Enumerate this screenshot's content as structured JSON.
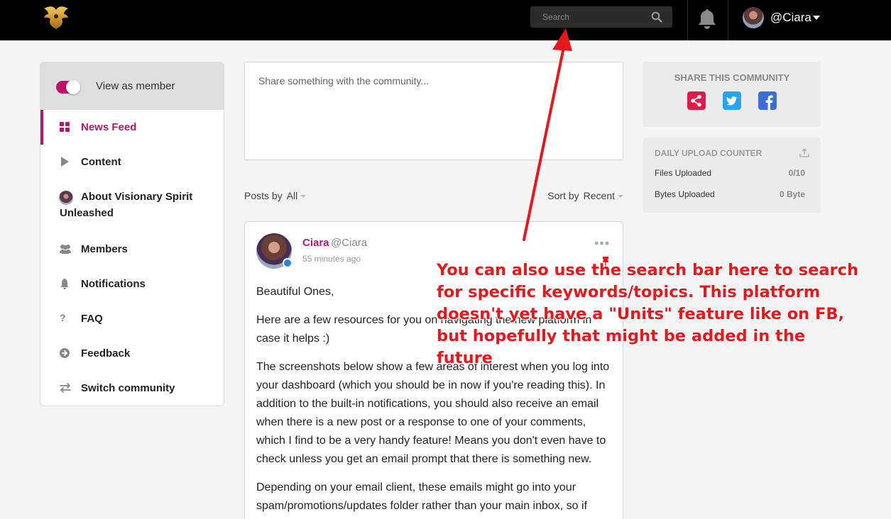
{
  "topbar": {
    "search_placeholder": "Search",
    "user_handle": "@Ciara"
  },
  "sidebar": {
    "view_as_member": "View as member",
    "items": [
      {
        "label": "News Feed",
        "icon": "grid-icon"
      },
      {
        "label": "Content",
        "icon": "play-icon"
      },
      {
        "label": "About Visionary Spirit Unleashed",
        "icon": "community-avatar-icon"
      },
      {
        "label": "Members",
        "icon": "members-icon"
      },
      {
        "label": "Notifications",
        "icon": "bell-icon"
      },
      {
        "label": "FAQ",
        "icon": "question-icon"
      },
      {
        "label": "Feedback",
        "icon": "arrow-circle-icon"
      },
      {
        "label": "Switch community",
        "icon": "switch-icon"
      }
    ]
  },
  "composer": {
    "placeholder": "Share something with the community..."
  },
  "filters": {
    "posts_by_label": "Posts by",
    "posts_by_value": "All",
    "sort_by_label": "Sort by",
    "sort_by_value": "Recent"
  },
  "post": {
    "author": "Ciara",
    "handle": "@Ciara",
    "time": "55 minutes ago",
    "paragraphs": [
      "Beautiful Ones,",
      "Here are a few resources for you on navigating the new platform in case it helps :)",
      "The screenshots below show a few areas of interest when you log into your dashboard (which you should be in now if you're reading this). In addition to the built-in notifications, you should also receive an email when there is a new post or a response to one of your comments, which I find to be a very handy feature! Means you don't even have to check unless you get an email prompt that there is something new.",
      "Depending on your email client, these emails might go into your spam/promotions/updates folder rather than your main inbox, so if"
    ]
  },
  "share": {
    "title": "SHARE THIS COMMUNITY"
  },
  "upload": {
    "title": "DAILY UPLOAD COUNTER",
    "files_label": "Files Uploaded",
    "files_value": "0/10",
    "bytes_label": "Bytes Uploaded",
    "bytes_value": "0 Byte"
  },
  "annotation": {
    "text": "You can also use the search bar here to search for specific keywords/topics. This platform doesn't yet have a \"Units\" feature like on FB, but hopefully that might be added in the future"
  },
  "colors": {
    "accent": "#b5176f",
    "annotation": "#e8171c",
    "topbar": "#000000"
  }
}
